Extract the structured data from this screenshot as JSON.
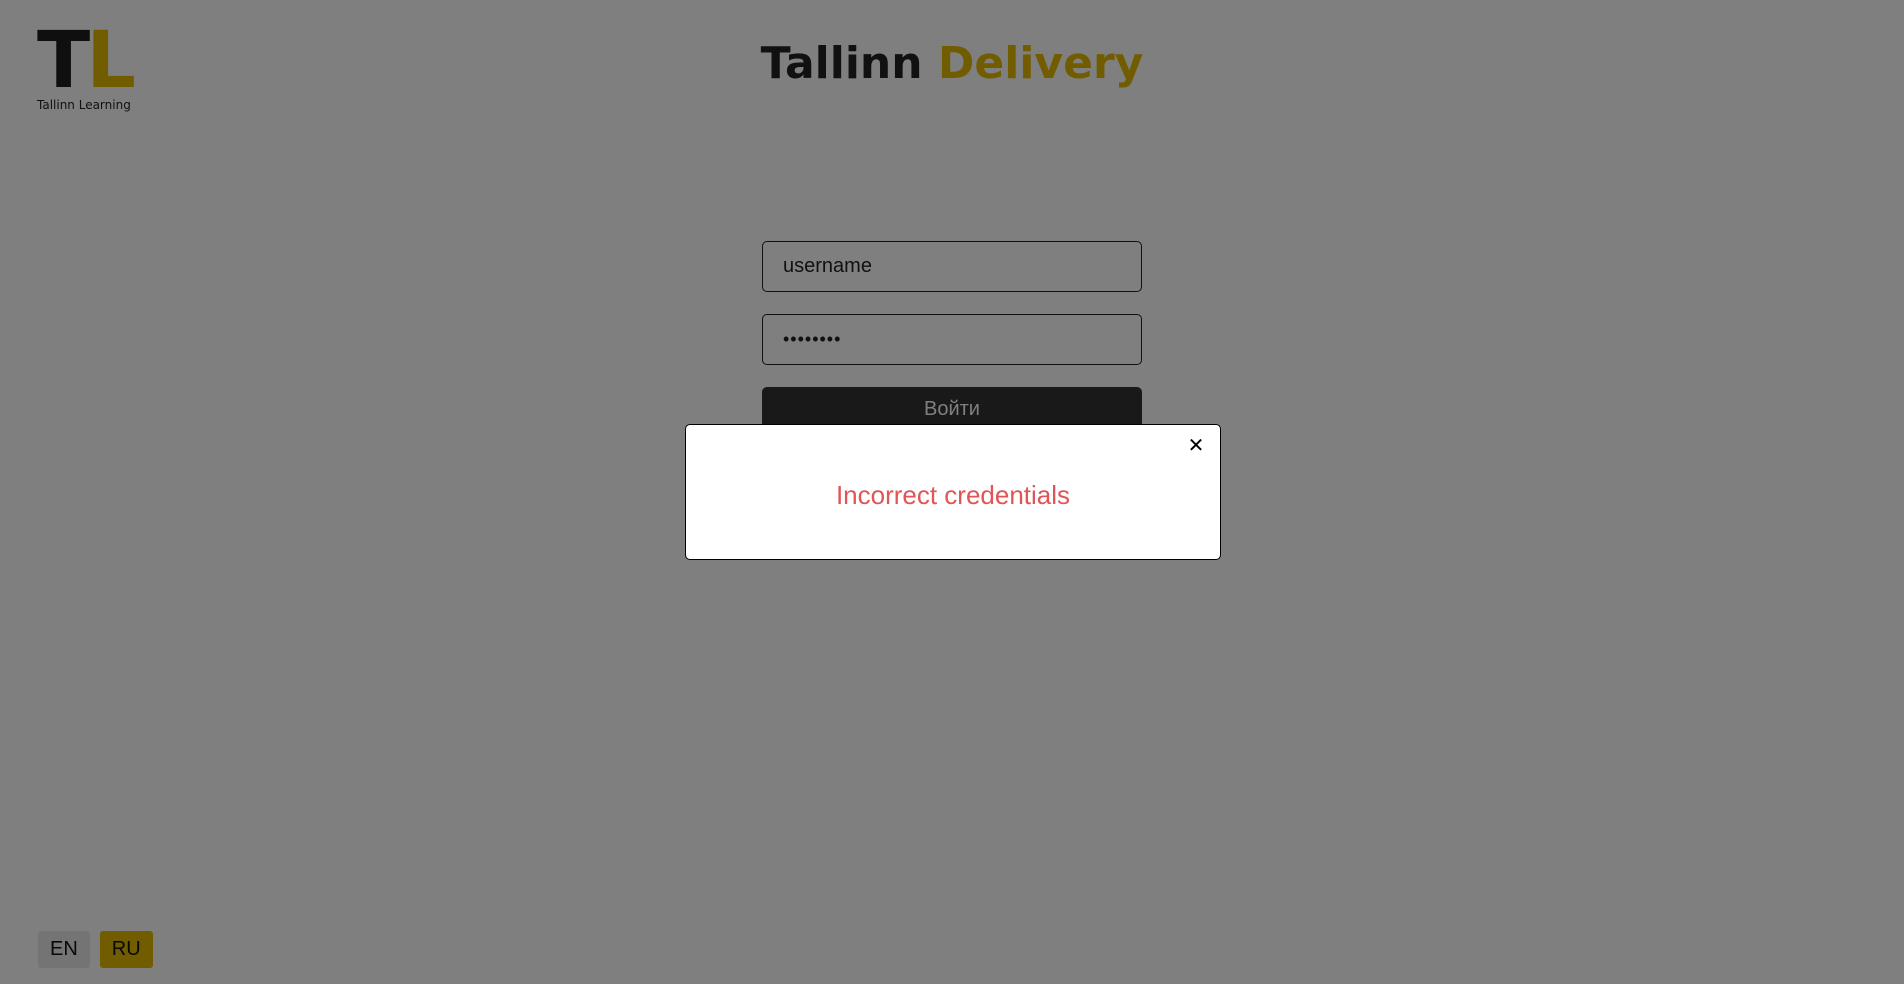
{
  "logo": {
    "letter_t": "T",
    "letter_l": "L",
    "subtitle": "Tallinn Learning"
  },
  "header": {
    "title_part1": "Tallinn",
    "title_part2": "Delivery"
  },
  "login": {
    "username_value": "username",
    "password_value": "••••••••",
    "submit_label": "Войти"
  },
  "language": {
    "options": [
      "EN",
      "RU"
    ],
    "selected": "RU"
  },
  "modal": {
    "message": "Incorrect credentials",
    "close_glyph": "✕"
  },
  "colors": {
    "accent": "#e5b800",
    "dark": "#222222",
    "error": "#e05555",
    "button": "#333333"
  }
}
